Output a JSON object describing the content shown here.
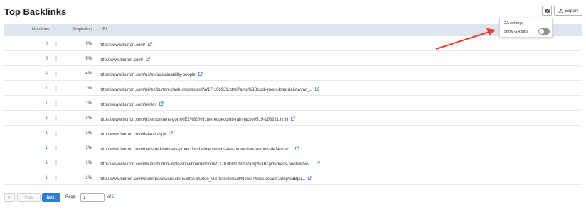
{
  "page": {
    "title": "Top Backlinks"
  },
  "toolbar": {
    "settings_icon": "gear-icon",
    "export_label": "Export",
    "export_icon": "export-icon"
  },
  "ga_popup": {
    "title": "GA settings",
    "toggle_label": "Show GA data",
    "toggle_on": false
  },
  "table": {
    "headers": {
      "mentions": "Mentions",
      "proportion": "Proportion",
      "url": "URL"
    },
    "rows": [
      {
        "mentions": "9",
        "proportion": "9%",
        "proportion_value": 0.09,
        "url": "https://www.burton.com/"
      },
      {
        "mentions": "5",
        "proportion": "5%",
        "proportion_value": 0.05,
        "url": "http://www.burton.com/"
      },
      {
        "mentions": "4",
        "proportion": "4%",
        "proportion_value": 0.04,
        "url": "https://www.burton.com/us/en/sustainability-people"
      },
      {
        "mentions": "1",
        "proportion": "1%",
        "proportion_value": 0.01,
        "url": "https://www.burton.com/uk/en/burton-clash-snowboard/W17-106931.html?amp%3Bcgid=mens-boards&dwvar_..."
      },
      {
        "mentions": "1",
        "proportion": "1%",
        "proportion_value": 0.01,
        "url": "https://www.burton.com/uk/en/"
      },
      {
        "mentions": "1",
        "proportion": "1%",
        "proportion_value": 0.01,
        "url": "https://www.burton.com/us/en/p/mens-gore%E2%80%91tex-edgecomb-rain-jacket/519-196221.html"
      },
      {
        "mentions": "1",
        "proportion": "1%",
        "proportion_value": 0.01,
        "url": "http://www.burton.com/default.aspx"
      },
      {
        "mentions": "1",
        "proportion": "1%",
        "proportion_value": 0.01,
        "url": "http://www.burton.com/mens-red-helmets-protection-helmets/mens-red-protection-helmets,default,sc..."
      },
      {
        "mentions": "1",
        "proportion": "1%",
        "proportion_value": 0.01,
        "url": "https://www.burton.com/uk/en/burton-moto-snowboard-boot/W17-104361.html?amp%3Bcgid=mens-boots&dwv..."
      },
      {
        "mentions": "1",
        "proportion": "1%",
        "proportion_value": 0.01,
        "url": "http://www.burton.com/on/demandware.store/Sites-Burton_US-Site/default/News-PressDetails?amp%3Bpa..."
      }
    ]
  },
  "pagination": {
    "first_label": "|<",
    "prev_label": "Prev",
    "next_label": "Next",
    "page_label": "Page:",
    "current_page": "1",
    "of_label": "of",
    "total_pages": "2"
  },
  "colors": {
    "accent": "#2d7ed7",
    "header_bg": "#dfe5ee",
    "annotation_arrow": "#e8412a"
  }
}
